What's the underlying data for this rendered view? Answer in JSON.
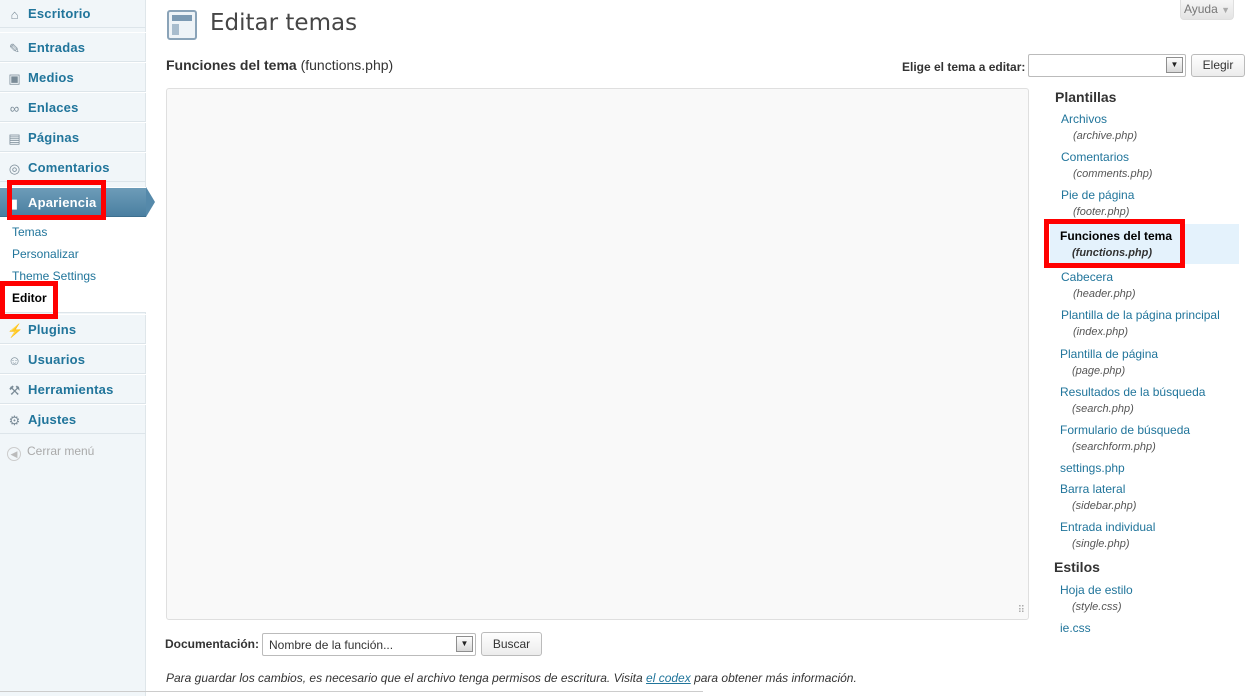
{
  "sidebar": {
    "items": [
      {
        "label": "Escritorio",
        "icon": "home-icon"
      },
      {
        "label": "Entradas",
        "icon": "pin-icon"
      },
      {
        "label": "Medios",
        "icon": "media-icon"
      },
      {
        "label": "Enlaces",
        "icon": "link-icon"
      },
      {
        "label": "Páginas",
        "icon": "page-icon"
      },
      {
        "label": "Comentarios",
        "icon": "comment-icon"
      },
      {
        "label": "Apariencia",
        "icon": "appearance-icon"
      },
      {
        "label": "Plugins",
        "icon": "plugin-icon"
      },
      {
        "label": "Usuarios",
        "icon": "users-icon"
      },
      {
        "label": "Herramientas",
        "icon": "tools-icon"
      },
      {
        "label": "Ajustes",
        "icon": "settings-icon"
      }
    ],
    "submenu": [
      "Temas",
      "Personalizar",
      "Theme Settings",
      "Editor"
    ],
    "collapse": "Cerrar menú"
  },
  "header": {
    "help": "Ayuda",
    "title": "Editar temas"
  },
  "editor": {
    "file_title": "Funciones del tema",
    "file_name": "(functions.php)",
    "theme_select_label": "Elige el tema a editar:",
    "theme_select_value": "",
    "choose_button": "Elegir"
  },
  "templates": {
    "heading": "Plantillas",
    "items": [
      {
        "name": "Archivos",
        "file": "(archive.php)"
      },
      {
        "name": "Comentarios",
        "file": "(comments.php)"
      },
      {
        "name": "Pie de página",
        "file": "(footer.php)"
      },
      {
        "name": "Funciones del tema",
        "file": "(functions.php)"
      },
      {
        "name": "Cabecera",
        "file": "(header.php)"
      },
      {
        "name": "Plantilla de la página principal",
        "file": "(index.php)"
      },
      {
        "name": "Plantilla de página",
        "file": "(page.php)"
      },
      {
        "name": "Resultados de la búsqueda",
        "file": "(search.php)"
      },
      {
        "name": "Formulario de búsqueda",
        "file": "(searchform.php)"
      },
      {
        "name": "settings.php",
        "file": ""
      },
      {
        "name": "Barra lateral",
        "file": "(sidebar.php)"
      },
      {
        "name": "Entrada individual",
        "file": "(single.php)"
      }
    ],
    "styles_heading": "Estilos",
    "styles": [
      {
        "name": "Hoja de estilo",
        "file": "(style.css)"
      },
      {
        "name": "ie.css",
        "file": ""
      }
    ]
  },
  "footer": {
    "doc_label": "Documentación:",
    "doc_select_value": "Nombre de la función...",
    "search_button": "Buscar",
    "notice_before": "Para guardar los cambios, es necesario que el archivo tenga permisos de escritura. Visita ",
    "notice_link": "el codex",
    "notice_after": " para obtener más información."
  }
}
